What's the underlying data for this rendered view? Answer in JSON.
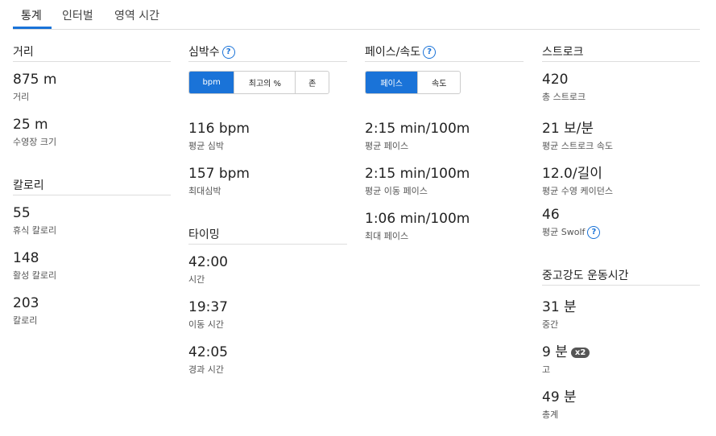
{
  "tabs": [
    "통계",
    "인터벌",
    "영역 시간"
  ],
  "distance": {
    "title": "거리",
    "items": [
      {
        "value": "875 m",
        "label": "거리"
      },
      {
        "value": "25 m",
        "label": "수영장 크기"
      }
    ]
  },
  "calories": {
    "title": "칼로리",
    "items": [
      {
        "value": "55",
        "label": "휴식 칼로리"
      },
      {
        "value": "148",
        "label": "활성 칼로리"
      },
      {
        "value": "203",
        "label": "칼로리"
      }
    ]
  },
  "heart": {
    "title": "심박수",
    "toggle": [
      "bpm",
      "최고의 %",
      "존"
    ],
    "items": [
      {
        "value": "116 bpm",
        "label": "평균 심박"
      },
      {
        "value": "157 bpm",
        "label": "최대심박"
      }
    ]
  },
  "timing": {
    "title": "타이밍",
    "items": [
      {
        "value": "42:00",
        "label": "시간"
      },
      {
        "value": "19:37",
        "label": "이동 시간"
      },
      {
        "value": "42:05",
        "label": "경과 시간"
      }
    ]
  },
  "pace": {
    "title": "페이스/속도",
    "toggle": [
      "페이스",
      "속도"
    ],
    "items": [
      {
        "value": "2:15 min/100m",
        "label": "평균 페이스"
      },
      {
        "value": "2:15 min/100m",
        "label": "평균 이동 페이스"
      },
      {
        "value": "1:06 min/100m",
        "label": "최대 페이스"
      }
    ]
  },
  "stroke": {
    "title": "스트로크",
    "items": [
      {
        "value": "420",
        "label": "총 스트로크"
      },
      {
        "value": "21 보/분",
        "label": "평균 스트로크 속도"
      },
      {
        "value": "12.0/길이",
        "label": "평균 수영 케이던스"
      },
      {
        "value": "46",
        "label": "평균 Swolf"
      }
    ]
  },
  "intensity": {
    "title": "중고강도 운동시간",
    "badge": "x2",
    "items": [
      {
        "value": "31 분",
        "label": "중간"
      },
      {
        "value": "9 분",
        "label": "고"
      },
      {
        "value": "49 분",
        "label": "총계"
      }
    ]
  },
  "help_glyph": "?",
  "colors": {
    "accent": "#1a73d8",
    "badge": "#555555"
  }
}
